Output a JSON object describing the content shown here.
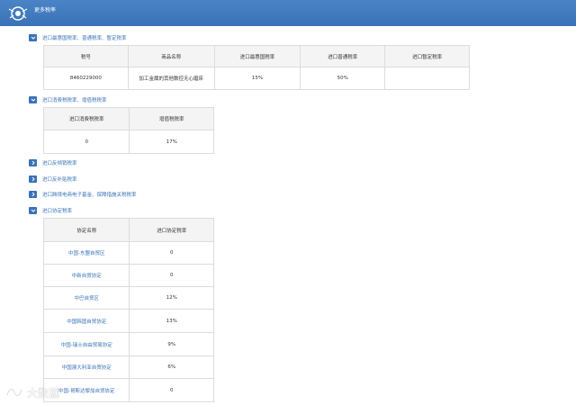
{
  "header": {
    "title": "更多税率"
  },
  "sections": {
    "mfn": {
      "title": "进口最惠国税率、普通税率、暂定税率"
    },
    "consumption": {
      "title": "进口消费税税率、增值税税率"
    },
    "antidumping": {
      "title": "进口反倾销税率"
    },
    "countervailing": {
      "title": "进口反补贴税率"
    },
    "ecommerce": {
      "title": "进口跨境电商电子基金、保障措施关税税率"
    },
    "agreement": {
      "title": "进口协定税率"
    }
  },
  "mfn_table": {
    "headers": [
      "税号",
      "商品名称",
      "进口最惠国税率",
      "进口普通税率",
      "进口暂定税率"
    ],
    "row": [
      "8460229000",
      "加工金属的其他数控无心磨床",
      "15%",
      "50%",
      ""
    ]
  },
  "consumption_table": {
    "headers": [
      "进口消费税税率",
      "增值税税率"
    ],
    "row": [
      "0",
      "17%"
    ]
  },
  "agreement_table": {
    "headers": [
      "协定名称",
      "进口协定税率"
    ],
    "rows": [
      {
        "name": "中国-东盟自贸区",
        "rate": "0"
      },
      {
        "name": "中新自贸协定",
        "rate": "0"
      },
      {
        "name": "中巴自贸区",
        "rate": "12%"
      },
      {
        "name": "中国韩国自贸协定",
        "rate": "13%"
      },
      {
        "name": "中国-瑞士自由贸易协定",
        "rate": "9%"
      },
      {
        "name": "中国澳大利亚自贸协定",
        "rate": "6%"
      },
      {
        "name": "中国-哥斯达黎加自贸协定",
        "rate": "0"
      }
    ]
  },
  "watermark": {
    "text": "大数据"
  },
  "icons": {
    "logo": "customs-emblem-icon",
    "expanded": "chevron-down-icon",
    "collapsed": "chevron-right-icon"
  },
  "colors": {
    "accent": "#3a72b7",
    "header_bg": "#4a84c6"
  }
}
